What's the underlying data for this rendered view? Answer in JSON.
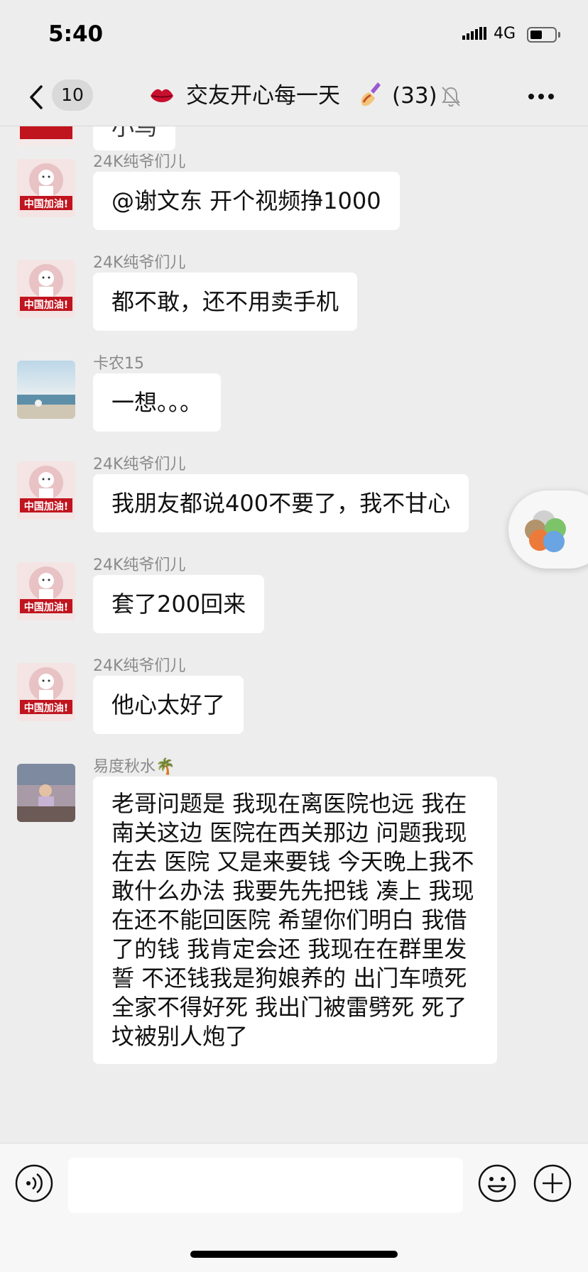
{
  "status_bar": {
    "time": "5:40",
    "network": "4G"
  },
  "nav": {
    "unread_count": "10",
    "title": "交友开心每一天",
    "member_count": "(33)"
  },
  "messages": [
    {
      "sender": "",
      "text": "小鸟"
    },
    {
      "sender": "24K纯爷们儿",
      "text": "@谢文东 开个视频挣1000",
      "avatar_text": "中国加油!"
    },
    {
      "sender": "24K纯爷们儿",
      "text": "都不敢，还不用卖手机",
      "avatar_text": "中国加油!"
    },
    {
      "sender": "卡农15",
      "text": "一想。。。"
    },
    {
      "sender": "24K纯爷们儿",
      "text": "我朋友都说400不要了，我不甘心",
      "avatar_text": "中国加油!"
    },
    {
      "sender": "24K纯爷们儿",
      "text": "套了200回来",
      "avatar_text": "中国加油!"
    },
    {
      "sender": "24K纯爷们儿",
      "text": "他心太好了",
      "avatar_text": "中国加油!"
    },
    {
      "sender": "易度秋水🌴",
      "text": "老哥问题是 我现在离医院也远 我在南关这边 医院在西关那边 问题我现在去 医院 又是来要钱 今天晚上我不敢什么办法 我要先先把钱 凑上    我现在还不能回医院 希望你们明白   我借了的钱 我肯定会还  我现在在群里发誓 不还钱我是狗娘养的    出门车喷死  全家不得好死      我出门被雷劈死   死了坟被别人炮了"
    }
  ],
  "icons": {
    "back": "chevron-left-icon",
    "lips": "lips-icon",
    "nail_polish": "nail-polish-icon",
    "mute": "bell-slash-icon",
    "more": "more-icon",
    "voice": "voice-icon",
    "emoji": "emoji-icon",
    "add": "add-icon"
  },
  "colors": {
    "background": "#ededed",
    "bubble": "#ffffff",
    "sender_name": "#8a8a8a",
    "badge": "#d9d9d9"
  }
}
